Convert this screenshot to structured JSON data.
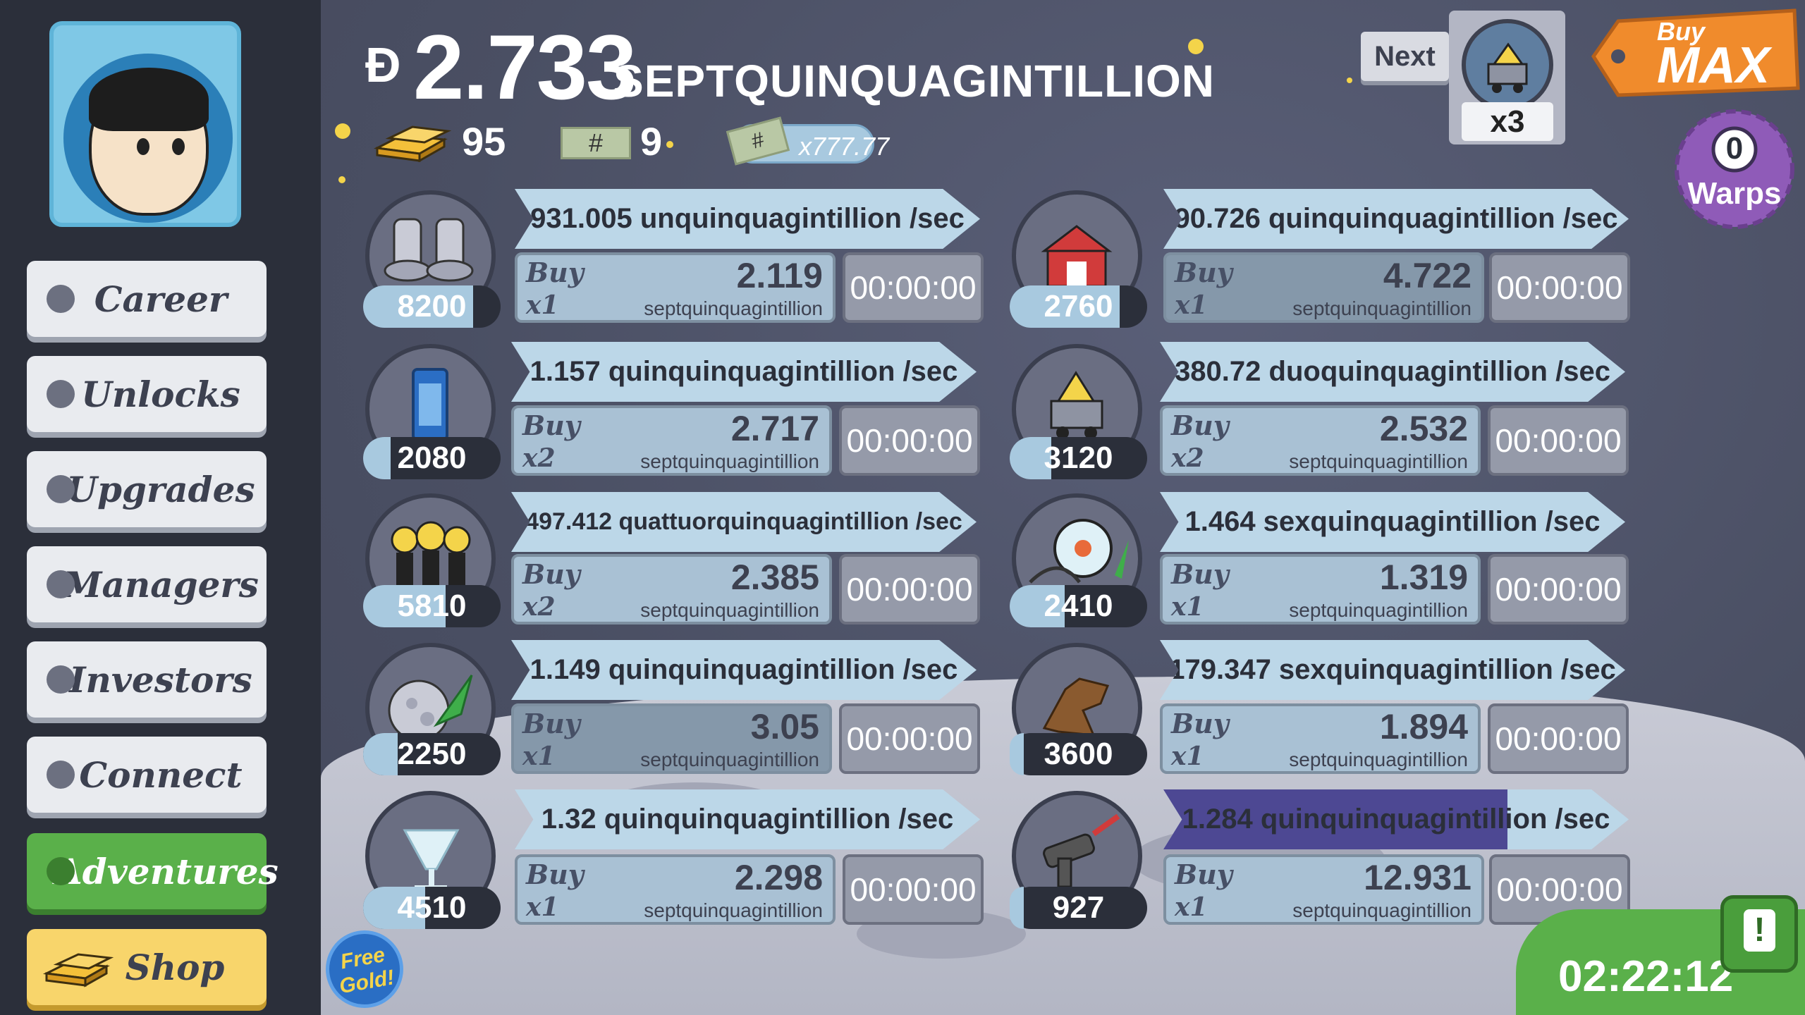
{
  "header": {
    "money_symbol": "Ð",
    "money_value": "2.733",
    "money_unit": "SEPTQUINQUAGINTILLION",
    "gold_count": "95",
    "ticket_symbol": "#",
    "ticket_count": "9",
    "multiplier_symbol": "#",
    "multiplier": "x777.77"
  },
  "top_right": {
    "next_label": "Next",
    "next_multiplier": "x3",
    "buy_label": "Buy",
    "max_label": "MAX",
    "warps_count": "0",
    "warps_label": "Warps"
  },
  "sidebar": {
    "items": [
      {
        "label": "Career"
      },
      {
        "label": "Unlocks"
      },
      {
        "label": "Upgrades"
      },
      {
        "label": "Managers"
      },
      {
        "label": "Investors"
      },
      {
        "label": "Connect"
      },
      {
        "label": "Adventures"
      },
      {
        "label": "Shop"
      }
    ]
  },
  "businesses": [
    {
      "icon": "boots-icon",
      "count": "8200",
      "progress": 0.8,
      "rate": "931.005 unquinquagintillion /sec",
      "buy": "Buy",
      "qty": "x1",
      "cost": "2.119",
      "unit": "septquinquagintillion",
      "timer": "00:00:00",
      "affordable": true,
      "rate_progress": 0
    },
    {
      "icon": "barn-icon",
      "count": "2760",
      "progress": 0.8,
      "rate": "90.726 quinquinquagintillion /sec",
      "buy": "Buy",
      "qty": "x1",
      "cost": "4.722",
      "unit": "septquinquagintillion",
      "timer": "00:00:00",
      "affordable": false,
      "rate_progress": 0
    },
    {
      "icon": "phone-booth-icon",
      "count": "2080",
      "progress": 0.2,
      "rate": "1.157 quinquinquagintillion /sec",
      "buy": "Buy",
      "qty": "x2",
      "cost": "2.717",
      "unit": "septquinquagintillion",
      "timer": "00:00:00",
      "affordable": true,
      "rate_progress": 0
    },
    {
      "icon": "cheese-cart-icon",
      "count": "3120",
      "progress": 0.3,
      "rate": "380.72 duoquinquagintillion /sec",
      "buy": "Buy",
      "qty": "x2",
      "cost": "2.532",
      "unit": "septquinquagintillion",
      "timer": "00:00:00",
      "affordable": true,
      "rate_progress": 0
    },
    {
      "icon": "aliens-icon",
      "count": "5810",
      "progress": 0.6,
      "rate": "497.412 quattuorquinquagintillion /sec",
      "buy": "Buy",
      "qty": "x2",
      "cost": "2.385",
      "unit": "septquinquagintillion",
      "timer": "00:00:00",
      "affordable": true,
      "rate_progress": 0
    },
    {
      "icon": "ferris-wheel-icon",
      "count": "2410",
      "progress": 0.4,
      "rate": "1.464 sexquinquagintillion /sec",
      "buy": "Buy",
      "qty": "x1",
      "cost": "1.319",
      "unit": "septquinquagintillion",
      "timer": "00:00:00",
      "affordable": true,
      "rate_progress": 0
    },
    {
      "icon": "moon-rocket-icon",
      "count": "2250",
      "progress": 0.25,
      "rate": "1.149 quinquinquagintillion /sec",
      "buy": "Buy",
      "qty": "x1",
      "cost": "3.05",
      "unit": "septquinquagintillion",
      "timer": "00:00:00",
      "affordable": false,
      "rate_progress": 0
    },
    {
      "icon": "werewolf-icon",
      "count": "3600",
      "progress": 0.1,
      "rate": "179.347 sexquinquagintillion /sec",
      "buy": "Buy",
      "qty": "x1",
      "cost": "1.894",
      "unit": "septquinquagintillion",
      "timer": "00:00:00",
      "affordable": true,
      "rate_progress": 0
    },
    {
      "icon": "cocktail-icon",
      "count": "4510",
      "progress": 0.45,
      "rate": "1.32 quinquinquagintillion /sec",
      "buy": "Buy",
      "qty": "x1",
      "cost": "2.298",
      "unit": "septquinquagintillion",
      "timer": "00:00:00",
      "affordable": true,
      "rate_progress": 0
    },
    {
      "icon": "ray-gun-icon",
      "count": "927",
      "progress": 0.1,
      "rate": "1.284 quinquinquagintillion /sec",
      "buy": "Buy",
      "qty": "x1",
      "cost": "12.931",
      "unit": "septquinquagintillion",
      "timer": "00:00:00",
      "affordable": true,
      "rate_progress": 0.74
    }
  ],
  "free_gold": {
    "line1": "Free",
    "line2": "Gold!"
  },
  "event_timer": "02:22:12",
  "colors": {
    "panel_bg": "#2b2f3a",
    "rate_banner": "#bcd7e8",
    "buy_box": "#a9c1d4",
    "active_green": "#5ab04a",
    "shop_yellow": "#f8d56b",
    "progress_purple": "#4d4893"
  }
}
